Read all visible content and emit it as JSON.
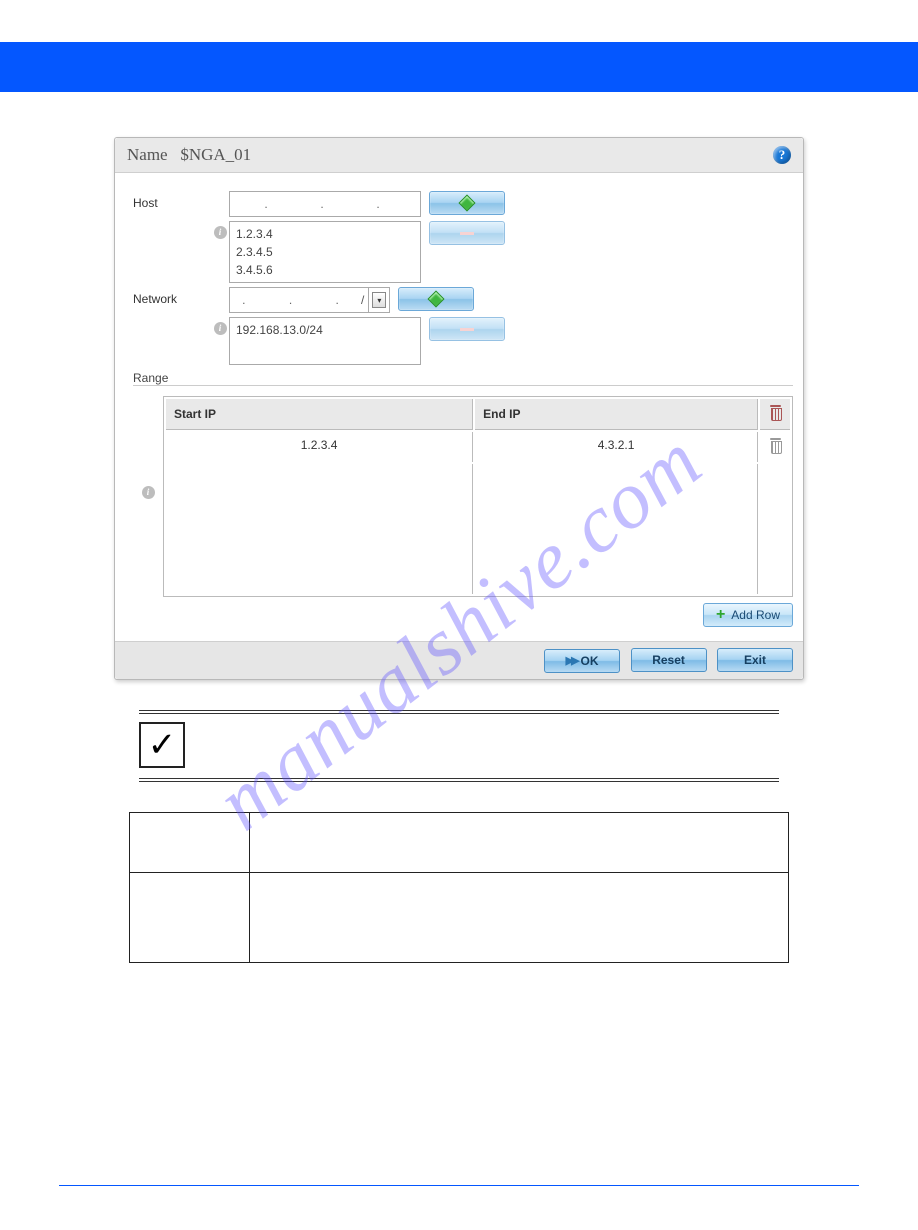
{
  "dialog": {
    "titleLabel": "Name",
    "titleValue": "$NGA_01",
    "host": {
      "label": "Host",
      "inputPlaceholder": ".     .     .",
      "list": [
        "1.2.3.4",
        "2.3.4.5",
        "3.4.5.6"
      ]
    },
    "network": {
      "label": "Network",
      "inputPlaceholder": ".    .    .",
      "slash": "/",
      "list": [
        "192.168.13.0/24"
      ]
    },
    "range": {
      "label": "Range",
      "col1": "Start IP",
      "col2": "End IP",
      "rows": [
        {
          "start": "1.2.3.4",
          "end": "4.3.2.1"
        }
      ],
      "addRowLabel": "Add Row"
    },
    "footer": {
      "ok": "OK",
      "reset": "Reset",
      "exit": "Exit"
    }
  },
  "watermark": "manualshive.com"
}
